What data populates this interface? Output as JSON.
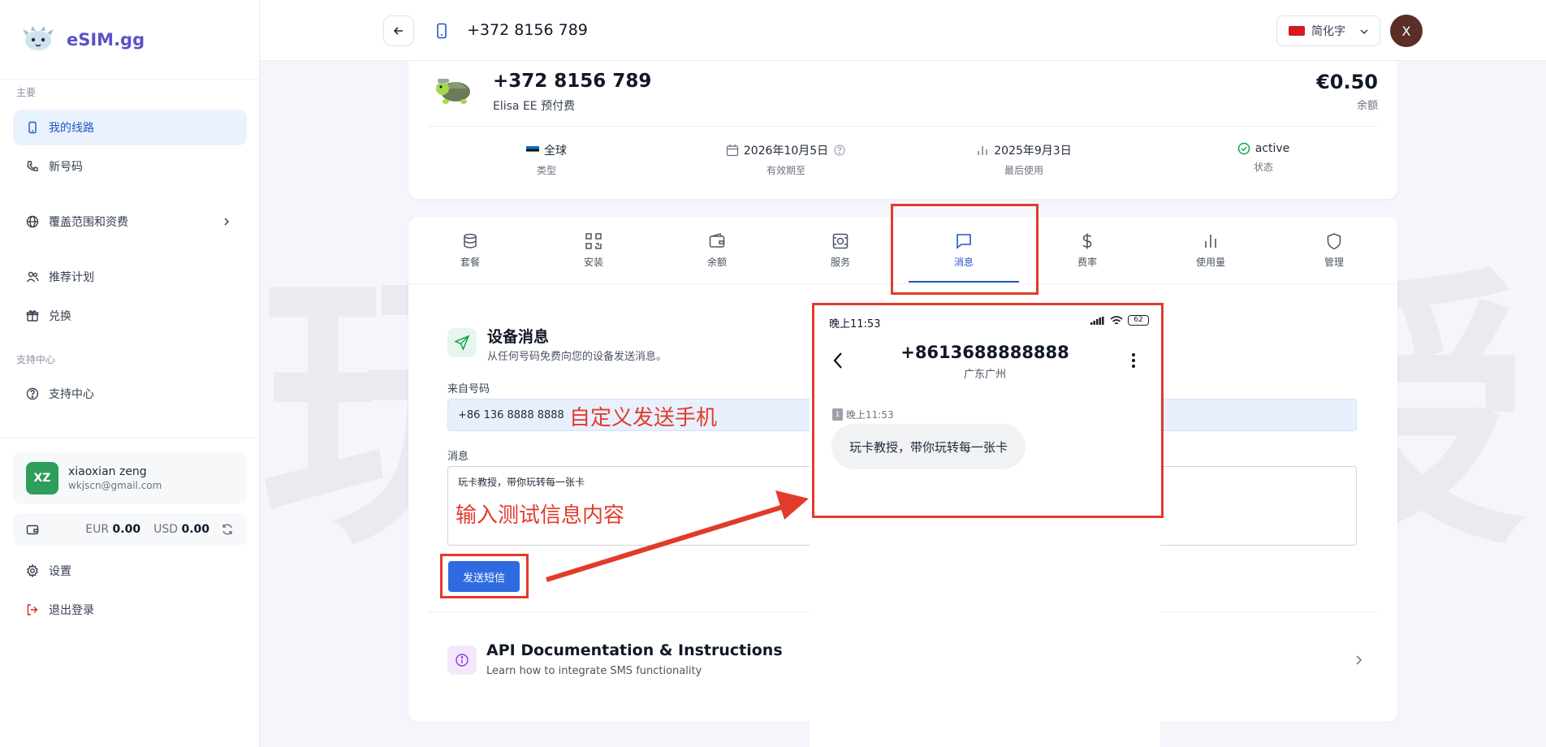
{
  "brand": {
    "name": "eSIM.gg"
  },
  "sidebar": {
    "section_main": "主要",
    "section_support": "支持中心",
    "items": [
      {
        "label": "我的线路"
      },
      {
        "label": "新号码"
      },
      {
        "label": "覆盖范围和资费"
      },
      {
        "label": "推荐计划"
      },
      {
        "label": "兑换"
      },
      {
        "label": "支持中心"
      },
      {
        "label": "设置"
      },
      {
        "label": "退出登录"
      }
    ],
    "user": {
      "initials": "XZ",
      "name": "xiaoxian zeng",
      "email": "wkjscn@gmail.com"
    },
    "wallet": {
      "eur_label": "EUR",
      "eur_value": "0.00",
      "usd_label": "USD",
      "usd_value": "0.00"
    }
  },
  "topbar": {
    "number": "+372 8156 789",
    "language": "简化字",
    "avatar_initial": "X"
  },
  "line": {
    "number": "+372 8156 789",
    "plan": "Elisa EE 预付费",
    "balance": "€0.50",
    "balance_label": "余额",
    "stats": [
      {
        "value": "全球",
        "label": "类型"
      },
      {
        "value": "2026年10月5日",
        "label": "有效期至"
      },
      {
        "value": "2025年9月3日",
        "label": "最后使用"
      },
      {
        "value": "active",
        "label": "状态"
      }
    ]
  },
  "tabs": [
    {
      "label": "套餐"
    },
    {
      "label": "安装"
    },
    {
      "label": "余额"
    },
    {
      "label": "服务"
    },
    {
      "label": "消息"
    },
    {
      "label": "费率"
    },
    {
      "label": "使用量"
    },
    {
      "label": "管理"
    }
  ],
  "messages": {
    "title": "设备消息",
    "subtitle": "从任何号码免费向您的设备发送消息。",
    "from_label": "来自号码",
    "from_value": "+86 136 8888 8888",
    "message_label": "消息",
    "message_value": "玩卡教授，带你玩转每一张卡",
    "send_label": "发送短信"
  },
  "api": {
    "title": "API Documentation & Instructions",
    "subtitle": "Learn how to integrate SMS functionality"
  },
  "annotations": {
    "custom_sender": "自定义发送手机",
    "input_test": "输入测试信息内容"
  },
  "watermark": "玩卡教授",
  "phone": {
    "time": "晚上11:53",
    "battery": "62",
    "contact_number": "+8613688888888",
    "contact_location": "广东广州",
    "sim_badge": "1",
    "message_time": "晚上11:53",
    "message_text": "玩卡教授，带你玩转每一张卡"
  },
  "colors": {
    "accent": "#2155c6",
    "annotation": "#e23b2a",
    "brand": "#5b53c7"
  }
}
